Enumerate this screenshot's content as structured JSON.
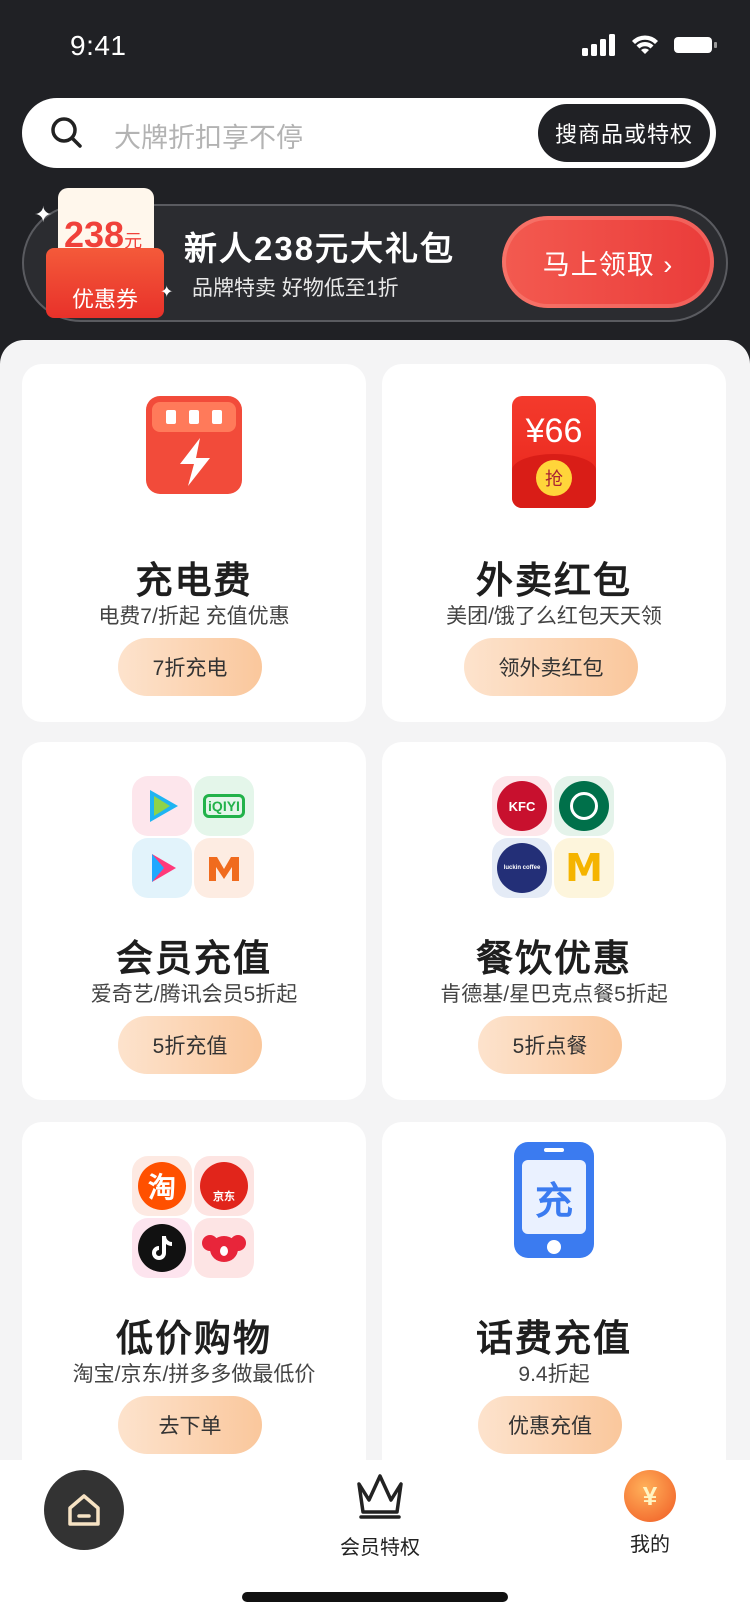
{
  "status_bar": {
    "time": "9:41"
  },
  "search": {
    "placeholder": "大牌折扣享不停",
    "button_label": "搜商品或特权"
  },
  "promo": {
    "coupon_value": "238",
    "coupon_unit": "元",
    "coupon_label": "优惠券",
    "title": "新人238元大礼包",
    "subtitle": "品牌特卖  好物低至1折",
    "button_label": "马上领取 ›"
  },
  "cards": [
    {
      "title": "充电费",
      "desc": "电费7/折起  充值优惠",
      "button": "7折充电",
      "icon": "charging-icon"
    },
    {
      "title": "外卖红包",
      "desc": "美团/饿了么红包天天领",
      "button": "领外卖红包",
      "icon": "red-envelope-icon",
      "icon_text": "¥66",
      "icon_badge": "抢"
    },
    {
      "title": "会员充值",
      "desc": "爱奇艺/腾讯会员5折起",
      "button": "5折充值",
      "icon": "video-apps-icon",
      "mini_apps": [
        "tencent-video-icon",
        "iqiyi-icon",
        "youku-icon",
        "mango-tv-icon"
      ],
      "iqiyi_text": "iQIYI"
    },
    {
      "title": "餐饮优惠",
      "desc": "肯德基/星巴克点餐5折起",
      "button": "5折点餐",
      "icon": "food-brands-icon",
      "mini_apps": [
        "kfc-icon",
        "starbucks-icon",
        "luckin-coffee-icon",
        "mcdonalds-icon"
      ],
      "kfc_text": "KFC",
      "luckin_text": "luckin coffee",
      "mcd_text": "M"
    },
    {
      "title": "低价购物",
      "desc": "淘宝/京东/拼多多做最低价",
      "button": "去下单",
      "icon": "shopping-apps-icon",
      "mini_apps": [
        "taobao-icon",
        "jd-icon",
        "tiktok-icon",
        "koala-icon"
      ],
      "taobao_text": "淘",
      "jd_text": "京东"
    },
    {
      "title": "话费充值",
      "desc": "9.4折起",
      "button": "优惠充值",
      "icon": "phone-recharge-icon",
      "icon_text": "充"
    }
  ],
  "tabbar": {
    "home": {
      "icon": "home-icon"
    },
    "member": {
      "label": "会员特权",
      "icon": "crown-icon"
    },
    "mine": {
      "label": "我的",
      "icon": "coin-icon",
      "icon_text": "¥"
    }
  },
  "colors": {
    "accent": "#f0413a",
    "dark": "#202125",
    "button_gradient": [
      "#fde3cd",
      "#fac79c"
    ]
  }
}
